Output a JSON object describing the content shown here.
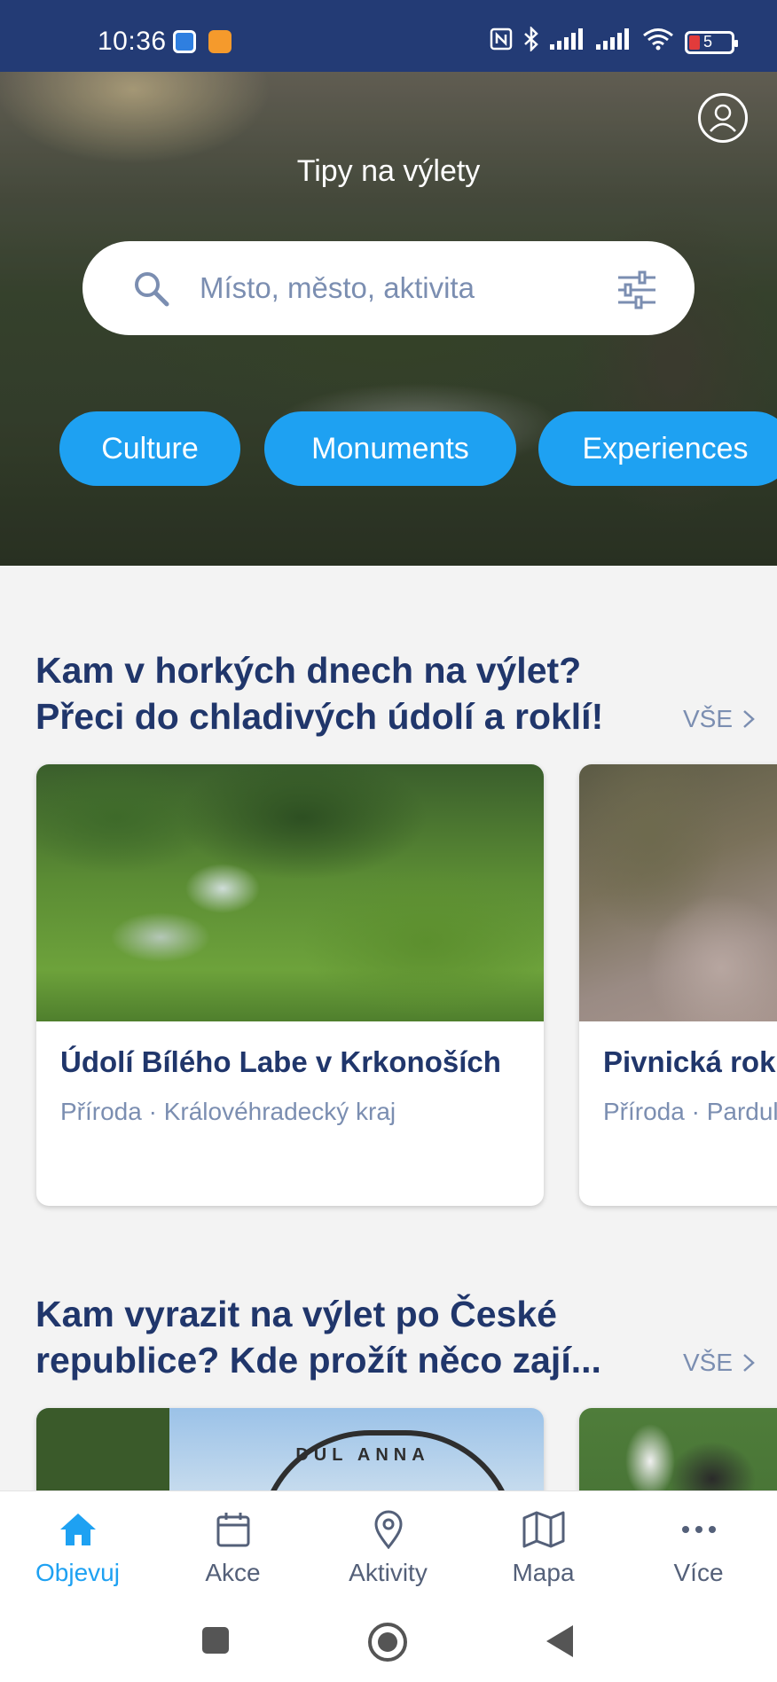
{
  "status_bar": {
    "time": "10:36",
    "icons": [
      "app-icon-blue",
      "app-icon-orange",
      "nfc-icon",
      "bluetooth-icon",
      "signal-icon",
      "signal-icon",
      "wifi-icon"
    ],
    "battery_level": "5"
  },
  "hero": {
    "title": "Tipy na výlety",
    "search_placeholder": "Místo, město, aktivita",
    "categories": [
      "Culture",
      "Monuments",
      "Experiences"
    ]
  },
  "sections": [
    {
      "title_line1": "Kam v horkých dnech na výlet?",
      "title_line2": "Přeci do chladivých údolí a roklí!",
      "see_all": "VŠE",
      "cards": [
        {
          "title": "Údolí Bílého Labe v Krkonoších",
          "subtitle": "Příroda · Královéhradecký kraj"
        },
        {
          "title": "Pivnická rok",
          "subtitle": "Příroda · Pardul"
        }
      ]
    },
    {
      "title_line1": "Kam vyrazit na výlet po České",
      "title_line2": "republice? Kde prožít něco zají...",
      "see_all": "VŠE",
      "cards": [
        {
          "image_text": "DŮL ANNA"
        },
        {}
      ]
    }
  ],
  "bottom_nav": [
    {
      "label": "Objevuj",
      "icon": "home-icon",
      "active": true
    },
    {
      "label": "Akce",
      "icon": "calendar-icon",
      "active": false
    },
    {
      "label": "Aktivity",
      "icon": "location-pin-icon",
      "active": false
    },
    {
      "label": "Mapa",
      "icon": "map-icon",
      "active": false
    },
    {
      "label": "Více",
      "icon": "more-icon",
      "active": false
    }
  ],
  "colors": {
    "status_bar": "#233b75",
    "accent": "#1ea1f2",
    "heading": "#20366b",
    "muted": "#7b8eb1"
  }
}
